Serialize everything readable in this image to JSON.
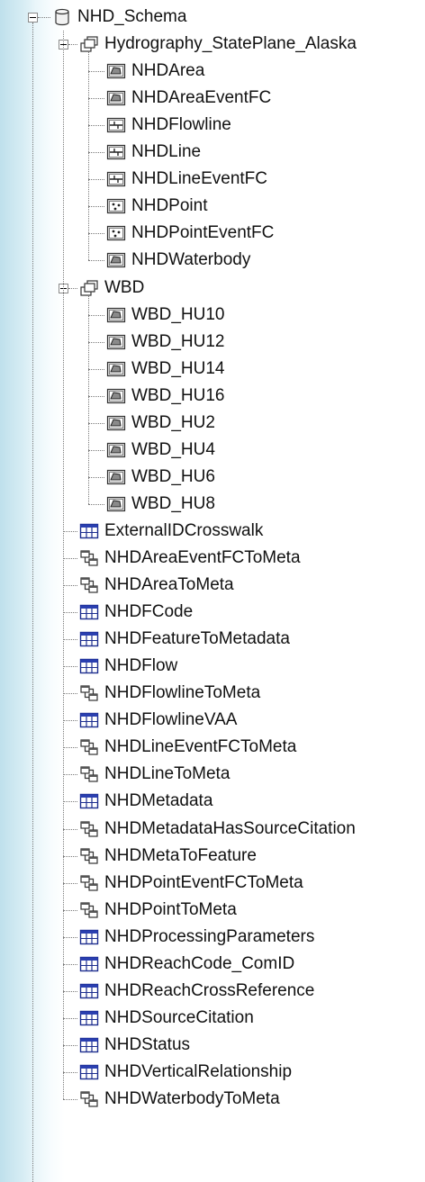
{
  "root": {
    "label": "NHD_Schema",
    "icon": "database-icon"
  },
  "datasets": [
    {
      "label": "Hydrography_StatePlane_Alaska",
      "icon": "feature-dataset-icon",
      "items": [
        {
          "label": "NHDArea",
          "icon": "polygon-feature-class-icon"
        },
        {
          "label": "NHDAreaEventFC",
          "icon": "polygon-feature-class-icon"
        },
        {
          "label": "NHDFlowline",
          "icon": "line-feature-class-icon"
        },
        {
          "label": "NHDLine",
          "icon": "line-feature-class-icon"
        },
        {
          "label": "NHDLineEventFC",
          "icon": "line-feature-class-icon"
        },
        {
          "label": "NHDPoint",
          "icon": "point-feature-class-icon"
        },
        {
          "label": "NHDPointEventFC",
          "icon": "point-feature-class-icon"
        },
        {
          "label": "NHDWaterbody",
          "icon": "polygon-feature-class-icon"
        }
      ]
    },
    {
      "label": "WBD",
      "icon": "feature-dataset-icon",
      "items": [
        {
          "label": "WBD_HU10",
          "icon": "polygon-feature-class-icon"
        },
        {
          "label": "WBD_HU12",
          "icon": "polygon-feature-class-icon"
        },
        {
          "label": "WBD_HU14",
          "icon": "polygon-feature-class-icon"
        },
        {
          "label": "WBD_HU16",
          "icon": "polygon-feature-class-icon"
        },
        {
          "label": "WBD_HU2",
          "icon": "polygon-feature-class-icon"
        },
        {
          "label": "WBD_HU4",
          "icon": "polygon-feature-class-icon"
        },
        {
          "label": "WBD_HU6",
          "icon": "polygon-feature-class-icon"
        },
        {
          "label": "WBD_HU8",
          "icon": "polygon-feature-class-icon"
        }
      ]
    }
  ],
  "objects": [
    {
      "label": "ExternalIDCrosswalk",
      "icon": "table-icon"
    },
    {
      "label": "NHDAreaEventFCToMeta",
      "icon": "relationship-class-icon"
    },
    {
      "label": "NHDAreaToMeta",
      "icon": "relationship-class-icon"
    },
    {
      "label": "NHDFCode",
      "icon": "table-icon"
    },
    {
      "label": "NHDFeatureToMetadata",
      "icon": "table-icon"
    },
    {
      "label": "NHDFlow",
      "icon": "table-icon"
    },
    {
      "label": "NHDFlowlineToMeta",
      "icon": "relationship-class-icon"
    },
    {
      "label": "NHDFlowlineVAA",
      "icon": "table-icon"
    },
    {
      "label": "NHDLineEventFCToMeta",
      "icon": "relationship-class-icon"
    },
    {
      "label": "NHDLineToMeta",
      "icon": "relationship-class-icon"
    },
    {
      "label": "NHDMetadata",
      "icon": "table-icon"
    },
    {
      "label": "NHDMetadataHasSourceCitation",
      "icon": "relationship-class-icon"
    },
    {
      "label": "NHDMetaToFeature",
      "icon": "relationship-class-icon"
    },
    {
      "label": "NHDPointEventFCToMeta",
      "icon": "relationship-class-icon"
    },
    {
      "label": "NHDPointToMeta",
      "icon": "relationship-class-icon"
    },
    {
      "label": "NHDProcessingParameters",
      "icon": "table-icon"
    },
    {
      "label": "NHDReachCode_ComID",
      "icon": "table-icon"
    },
    {
      "label": "NHDReachCrossReference",
      "icon": "table-icon"
    },
    {
      "label": "NHDSourceCitation",
      "icon": "table-icon"
    },
    {
      "label": "NHDStatus",
      "icon": "table-icon"
    },
    {
      "label": "NHDVerticalRelationship",
      "icon": "table-icon"
    },
    {
      "label": "NHDWaterbodyToMeta",
      "icon": "relationship-class-icon"
    }
  ]
}
